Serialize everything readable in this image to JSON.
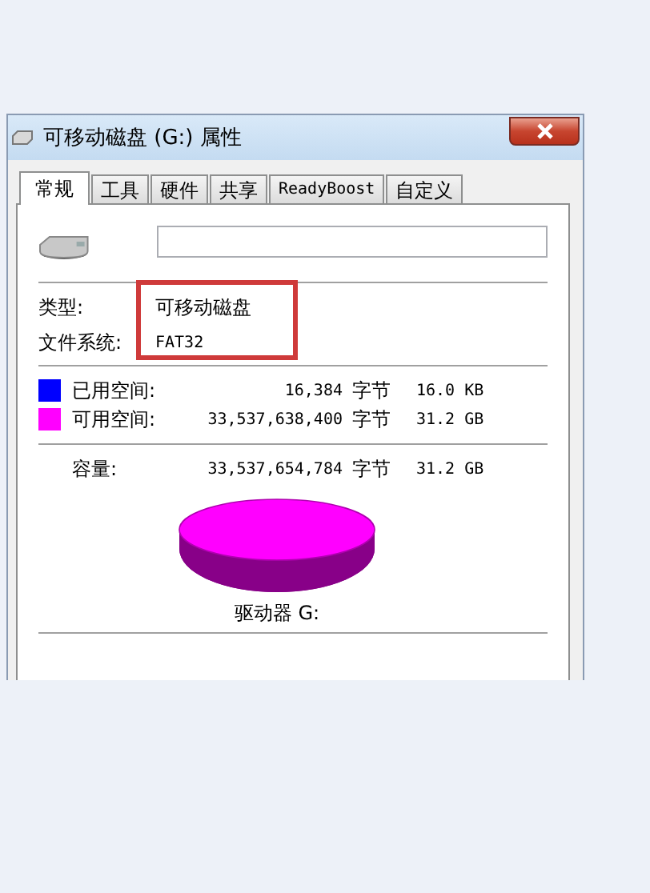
{
  "window": {
    "title": "可移动磁盘 (G:) 属性"
  },
  "tabs": [
    {
      "label": "常规",
      "selected": true
    },
    {
      "label": "工具",
      "selected": false
    },
    {
      "label": "硬件",
      "selected": false
    },
    {
      "label": "共享",
      "selected": false
    },
    {
      "label": "ReadyBoost",
      "selected": false
    },
    {
      "label": "自定义",
      "selected": false
    }
  ],
  "info": {
    "highlighted": true,
    "rows": [
      {
        "label": "类型:",
        "value": "可移动磁盘"
      },
      {
        "label": "文件系统:",
        "value": "FAT32"
      }
    ]
  },
  "space": [
    {
      "label": "已用空间:",
      "bytes": "16,384",
      "unit": "字节",
      "size": "16.0 KB",
      "color": "#0000ff"
    },
    {
      "label": "可用空间:",
      "bytes": "33,537,638,400",
      "unit": "字节",
      "size": "31.2 GB",
      "color": "#ff00ff"
    }
  ],
  "capacity": {
    "label": "容量:",
    "bytes": "33,537,654,784",
    "unit": "字节",
    "size": "31.2 GB"
  },
  "drive_label": "驱动器 G:"
}
